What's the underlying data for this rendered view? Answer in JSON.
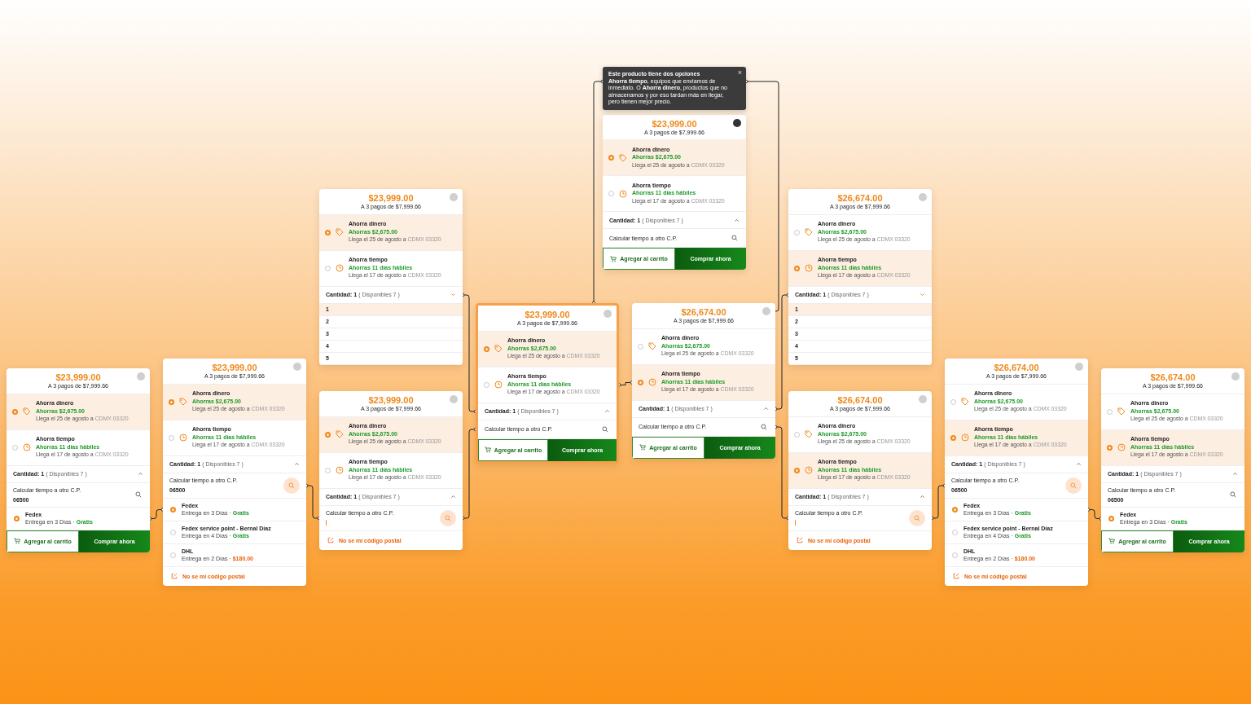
{
  "cards": [
    {
      "price": "$23,999.00",
      "installments": "A 3 pagos de $7,999.66",
      "highlighted": false,
      "info_active": false,
      "options": [
        {
          "kind": "money",
          "title": "Ahorra dinero",
          "savings": "Ahorras $2,675.00",
          "arrival": "Llega el 25 de agosto a",
          "location": "CDMX 03320",
          "selected": true
        },
        {
          "kind": "time",
          "title": "Ahorra tiempo",
          "savings": "Ahorras 11 días hábiles",
          "arrival": "Llega el 17 de agosto a",
          "location": "CDMX 03320",
          "selected": false
        }
      ],
      "quantity": {
        "label": "Cantidad:",
        "value": "1",
        "available": "( Disponibles 7 )",
        "expanded": false
      },
      "postal": {
        "label": "Calcular tiempo a otro C.P.",
        "value": "06500",
        "active": false
      },
      "shipping": [
        {
          "carrier": "Fedex",
          "delivery": "Entrega en 3 Días ·",
          "cost": "Gratis",
          "kind": "free",
          "selected": true
        }
      ],
      "actions": {
        "add": "Agregar al carrito",
        "buy": "Comprar ahora"
      }
    },
    {
      "price": "$23,999.00",
      "installments": "A 3 pagos de $7,999.66",
      "highlighted": false,
      "info_active": false,
      "options": [
        {
          "kind": "money",
          "title": "Ahorra dinero",
          "savings": "Ahorras $2,675.00",
          "arrival": "Llega el 25 de agosto a",
          "location": "CDMX 03320",
          "selected": true
        },
        {
          "kind": "time",
          "title": "Ahorra tiempo",
          "savings": "Ahorras 11 días hábiles",
          "arrival": "Llega el 17 de agosto a",
          "location": "CDMX 03320",
          "selected": false
        }
      ],
      "quantity": {
        "label": "Cantidad:",
        "value": "1",
        "available": "( Disponibles 7 )",
        "expanded": false
      },
      "postal": {
        "label": "Calcular tiempo a otro C.P.",
        "value": "06500",
        "active": true
      },
      "shipping": [
        {
          "carrier": "Fedex",
          "delivery": "Entrega en 3 Días ·",
          "cost": "Gratis",
          "kind": "free",
          "selected": true
        },
        {
          "carrier": "Fedex service point - Bernal Díaz",
          "delivery": "Entrega en 4 Días ·",
          "cost": "Gratis",
          "kind": "free",
          "selected": false
        },
        {
          "carrier": "DHL",
          "delivery": "Entrega en 2 Días ·",
          "cost": "$180.00",
          "kind": "paid",
          "selected": false
        }
      ],
      "postal_link": "No se mi código postal"
    },
    {
      "price": "$23,999.00",
      "installments": "A 3 pagos de $7,999.66",
      "highlighted": false,
      "info_active": false,
      "options": [
        {
          "kind": "money",
          "title": "Ahorra dinero",
          "savings": "Ahorras $2,675.00",
          "arrival": "Llega el 25 de agosto a",
          "location": "CDMX 03320",
          "selected": true
        },
        {
          "kind": "time",
          "title": "Ahorra tiempo",
          "savings": "Ahorras 11 días hábiles",
          "arrival": "Llega el 17 de agosto a",
          "location": "CDMX 03320",
          "selected": false
        }
      ],
      "quantity": {
        "label": "Cantidad:",
        "value": "1",
        "available": "( Disponibles 7 )",
        "expanded": true
      },
      "quantity_options": [
        {
          "label": "1",
          "selected": true
        },
        {
          "label": "2",
          "selected": false
        },
        {
          "label": "3",
          "selected": false
        },
        {
          "label": "4",
          "selected": false
        },
        {
          "label": "5",
          "selected": false
        }
      ]
    },
    {
      "price": "$23,999.00",
      "installments": "A 3 pagos de $7,999.66",
      "highlighted": false,
      "info_active": false,
      "options": [
        {
          "kind": "money",
          "title": "Ahorra dinero",
          "savings": "Ahorras $2,675.00",
          "arrival": "Llega el 25 de agosto a",
          "location": "CDMX 03320",
          "selected": true
        },
        {
          "kind": "time",
          "title": "Ahorra tiempo",
          "savings": "Ahorras 11 días hábiles",
          "arrival": "Llega el 17 de agosto a",
          "location": "CDMX 03320",
          "selected": false
        }
      ],
      "quantity": {
        "label": "Cantidad:",
        "value": "1",
        "available": "( Disponibles 7 )",
        "expanded": false
      },
      "postal": {
        "label": "Calcular tiempo a otro C.P.",
        "active": true
      },
      "postal_link": "No se mi código postal"
    },
    {
      "price": "$23,999.00",
      "installments": "A 3 pagos de $7,999.66",
      "highlighted": true,
      "info_active": false,
      "options": [
        {
          "kind": "money",
          "title": "Ahorra dinero",
          "savings": "Ahorras $2,675.00",
          "arrival": "Llega el 25 de agosto a",
          "location": "CDMX 03320",
          "selected": true
        },
        {
          "kind": "time",
          "title": "Ahorra tiempo",
          "savings": "Ahorras 11 días hábiles",
          "arrival": "Llega el 17 de agosto a",
          "location": "CDMX 03320",
          "selected": false
        }
      ],
      "quantity": {
        "label": "Cantidad:",
        "value": "1",
        "available": "( Disponibles 7 )",
        "expanded": false
      },
      "postal": {
        "label": "Calcular tiempo a otro C.P.",
        "active": false
      },
      "actions": {
        "add": "Agregar al carrito",
        "buy": "Comprar ahora"
      }
    },
    {
      "tooltip": {
        "title": "Este producto tiene dos opciones",
        "text": "**Ahorra tiempo**, equipos que enviamos de inmediato. O **Ahorra dinero**, productos que no almacenamos y por eso tardan más en llegar, pero tienen mejor precio.",
        "close": "×"
      },
      "price": "$23,999.00",
      "installments": "A 3 pagos de $7,999.66",
      "highlighted": false,
      "info_active": true,
      "options": [
        {
          "kind": "money",
          "title": "Ahorra dinero",
          "savings": "Ahorras $2,675.00",
          "arrival": "Llega el 25 de agosto a",
          "location": "CDMX 03320",
          "selected": true
        },
        {
          "kind": "time",
          "title": "Ahorra tiempo",
          "savings": "Ahorras 11 días hábiles",
          "arrival": "Llega el 17 de agosto a",
          "location": "CDMX 03320",
          "selected": false
        }
      ],
      "quantity": {
        "label": "Cantidad:",
        "value": "1",
        "available": "( Disponibles 7 )",
        "expanded": false
      },
      "postal": {
        "label": "Calcular tiempo a otro C.P.",
        "active": false
      },
      "actions": {
        "add": "Agregar al carrito",
        "buy": "Comprar ahora"
      }
    },
    {
      "price": "$26,674.00",
      "installments": "A 3 pagos de $7,999.66",
      "highlighted": false,
      "info_active": false,
      "options": [
        {
          "kind": "money",
          "title": "Ahorra dinero",
          "savings": "Ahorras $2,675.00",
          "arrival": "Llega el 25 de agosto a",
          "location": "CDMX 03320",
          "selected": false
        },
        {
          "kind": "time",
          "title": "Ahorra tiempo",
          "savings": "Ahorras 11 días hábiles",
          "arrival": "Llega el 17 de agosto a",
          "location": "CDMX 03320",
          "selected": true
        }
      ],
      "quantity": {
        "label": "Cantidad:",
        "value": "1",
        "available": "( Disponibles 7 )",
        "expanded": false
      },
      "postal": {
        "label": "Calcular tiempo a otro C.P.",
        "active": false
      },
      "actions": {
        "add": "Agregar al carrito",
        "buy": "Comprar ahora"
      }
    },
    {
      "price": "$26,674.00",
      "installments": "A 3 pagos de $7,999.66",
      "highlighted": false,
      "info_active": false,
      "options": [
        {
          "kind": "money",
          "title": "Ahorra dinero",
          "savings": "Ahorras $2,675.00",
          "arrival": "Llega el 25 de agosto a",
          "location": "CDMX 03320",
          "selected": false
        },
        {
          "kind": "time",
          "title": "Ahorra tiempo",
          "savings": "Ahorras 11 días hábiles",
          "arrival": "Llega el 17 de agosto a",
          "location": "CDMX 03320",
          "selected": true
        }
      ],
      "quantity": {
        "label": "Cantidad:",
        "value": "1",
        "available": "( Disponibles 7 )",
        "expanded": true
      },
      "quantity_options": [
        {
          "label": "1",
          "selected": true
        },
        {
          "label": "2",
          "selected": false
        },
        {
          "label": "3",
          "selected": false
        },
        {
          "label": "4",
          "selected": false
        },
        {
          "label": "5",
          "selected": false
        }
      ]
    },
    {
      "price": "$26,674.00",
      "installments": "A 3 pagos de $7,999.66",
      "highlighted": false,
      "info_active": false,
      "options": [
        {
          "kind": "money",
          "title": "Ahorra dinero",
          "savings": "Ahorras $2,675.00",
          "arrival": "Llega el 25 de agosto a",
          "location": "CDMX 03320",
          "selected": false
        },
        {
          "kind": "time",
          "title": "Ahorra tiempo",
          "savings": "Ahorras 11 días hábiles",
          "arrival": "Llega el 17 de agosto a",
          "location": "CDMX 03320",
          "selected": true
        }
      ],
      "quantity": {
        "label": "Cantidad:",
        "value": "1",
        "available": "( Disponibles 7 )",
        "expanded": false
      },
      "postal": {
        "label": "Calcular tiempo a otro C.P.",
        "active": true
      },
      "postal_link": "No se mi código postal"
    },
    {
      "price": "$26,674.00",
      "installments": "A 3 pagos de $7,999.66",
      "highlighted": false,
      "info_active": false,
      "options": [
        {
          "kind": "money",
          "title": "Ahorra dinero",
          "savings": "Ahorras $2,675.00",
          "arrival": "Llega el 25 de agosto a",
          "location": "CDMX 03320",
          "selected": false
        },
        {
          "kind": "time",
          "title": "Ahorra tiempo",
          "savings": "Ahorras 11 días hábiles",
          "arrival": "Llega el 17 de agosto a",
          "location": "CDMX 03320",
          "selected": true
        }
      ],
      "quantity": {
        "label": "Cantidad:",
        "value": "1",
        "available": "( Disponibles 7 )",
        "expanded": false
      },
      "postal": {
        "label": "Calcular tiempo a otro C.P.",
        "value": "06500",
        "active": true
      },
      "shipping": [
        {
          "carrier": "Fedex",
          "delivery": "Entrega en 3 Días ·",
          "cost": "Gratis",
          "kind": "free",
          "selected": true
        },
        {
          "carrier": "Fedex service point - Bernal Díaz",
          "delivery": "Entrega en 4 Días ·",
          "cost": "Gratis",
          "kind": "free",
          "selected": false
        },
        {
          "carrier": "DHL",
          "delivery": "Entrega en 2 Días ·",
          "cost": "$180.00",
          "kind": "paid",
          "selected": false
        }
      ],
      "postal_link": "No se mi código postal"
    },
    {
      "price": "$26,674.00",
      "installments": "A 3 pagos de $7,999.66",
      "highlighted": false,
      "info_active": false,
      "options": [
        {
          "kind": "money",
          "title": "Ahorra dinero",
          "savings": "Ahorras $2,675.00",
          "arrival": "Llega el 25 de agosto a",
          "location": "CDMX 03320",
          "selected": false
        },
        {
          "kind": "time",
          "title": "Ahorra tiempo",
          "savings": "Ahorras 11 días hábiles",
          "arrival": "Llega el 17 de agosto a",
          "location": "CDMX 03320",
          "selected": true
        }
      ],
      "quantity": {
        "label": "Cantidad:",
        "value": "1",
        "available": "( Disponibles 7 )",
        "expanded": false
      },
      "postal": {
        "label": "Calcular tiempo a otro C.P.",
        "value": "06500",
        "active": false
      },
      "shipping": [
        {
          "carrier": "Fedex",
          "delivery": "Entrega en 3 Días ·",
          "cost": "Gratis",
          "kind": "free",
          "selected": true
        }
      ],
      "actions": {
        "add": "Agregar al carrito",
        "buy": "Comprar ahora"
      }
    }
  ]
}
